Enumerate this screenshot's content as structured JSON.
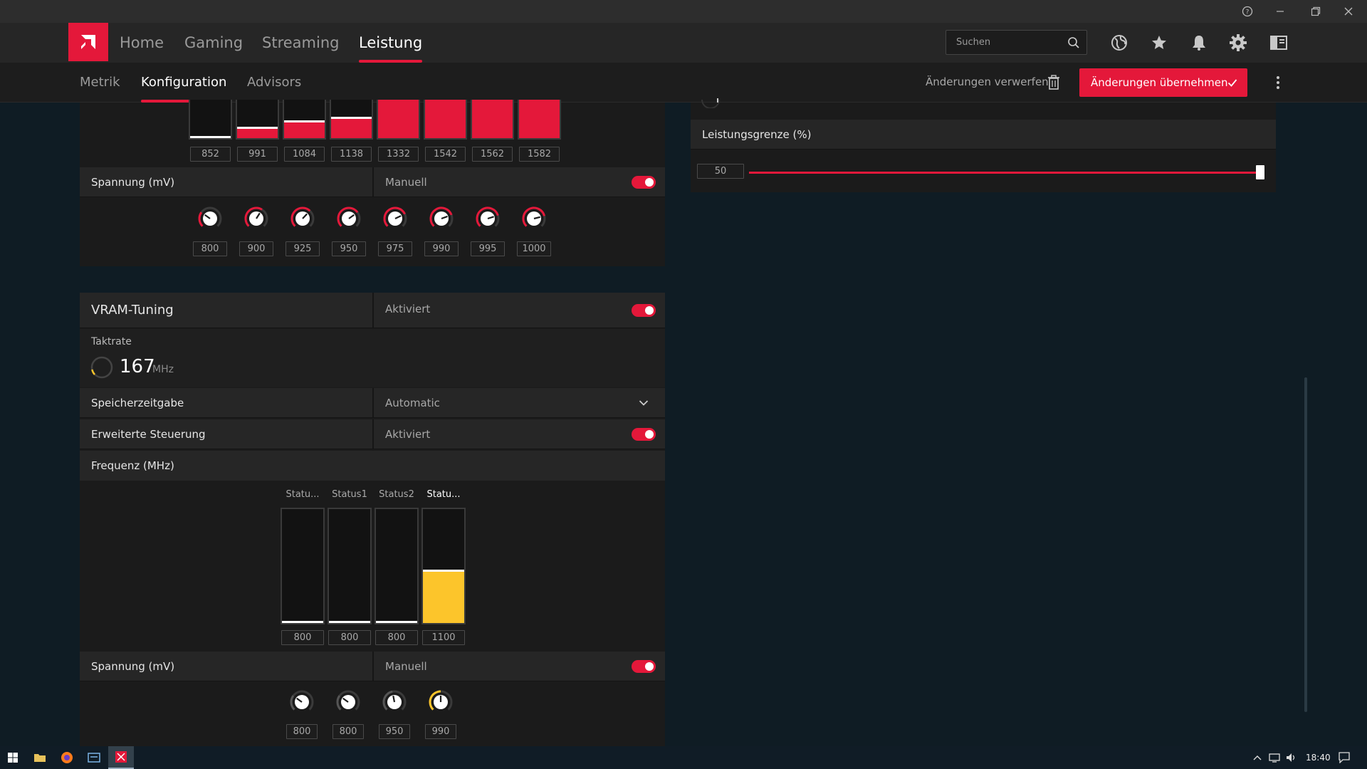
{
  "colors": {
    "accent": "#e4183a",
    "yellow": "#fcc52b",
    "bg": "#0f1c24"
  },
  "nav": {
    "items": [
      "Home",
      "Gaming",
      "Streaming",
      "Leistung"
    ],
    "active": "Leistung"
  },
  "search": {
    "placeholder": "Suchen"
  },
  "top_icons": [
    "globe-icon",
    "star-icon",
    "bell-icon",
    "gear-icon",
    "sidebar-panel-icon"
  ],
  "subnav": {
    "items": [
      "Metrik",
      "Konfiguration",
      "Advisors"
    ],
    "active": "Konfiguration",
    "discard_label": "Änderungen verwerfen",
    "apply_label": "Änderungen übernehmen"
  },
  "gpu": {
    "freq_values": [
      "852",
      "991",
      "1084",
      "1138",
      "1332",
      "1542",
      "1562",
      "1582"
    ],
    "freq_fill": [
      0,
      0.25,
      0.4,
      0.5,
      1,
      1,
      1,
      1
    ],
    "voltage_label": "Spannung (mV)",
    "voltage_mode": "Manuell",
    "voltage_values": [
      "800",
      "900",
      "925",
      "950",
      "975",
      "990",
      "995",
      "1000"
    ]
  },
  "power": {
    "label": "Leistungsgrenze (%)",
    "value": "50",
    "level_percent": 50
  },
  "vram": {
    "title": "VRAM-Tuning",
    "status": "Aktiviert",
    "clock_label": "Taktrate",
    "clock_value": "167",
    "clock_unit": "MHz",
    "timing_label": "Speicherzeitgabe",
    "timing_value": "Automatic",
    "advanced_label": "Erweiterte Steuerung",
    "advanced_value": "Aktiviert",
    "freq_label": "Frequenz (MHz)",
    "states": [
      "Statu...",
      "Status1",
      "Status2",
      "Statu..."
    ],
    "state_values": [
      "800",
      "800",
      "800",
      "1100"
    ],
    "state_fill": [
      0,
      0,
      0,
      0.45
    ],
    "voltage_label": "Spannung (mV)",
    "voltage_mode": "Manuell",
    "voltage_values": [
      "800",
      "800",
      "950",
      "990"
    ]
  },
  "taskbar": {
    "time": "18:40"
  }
}
